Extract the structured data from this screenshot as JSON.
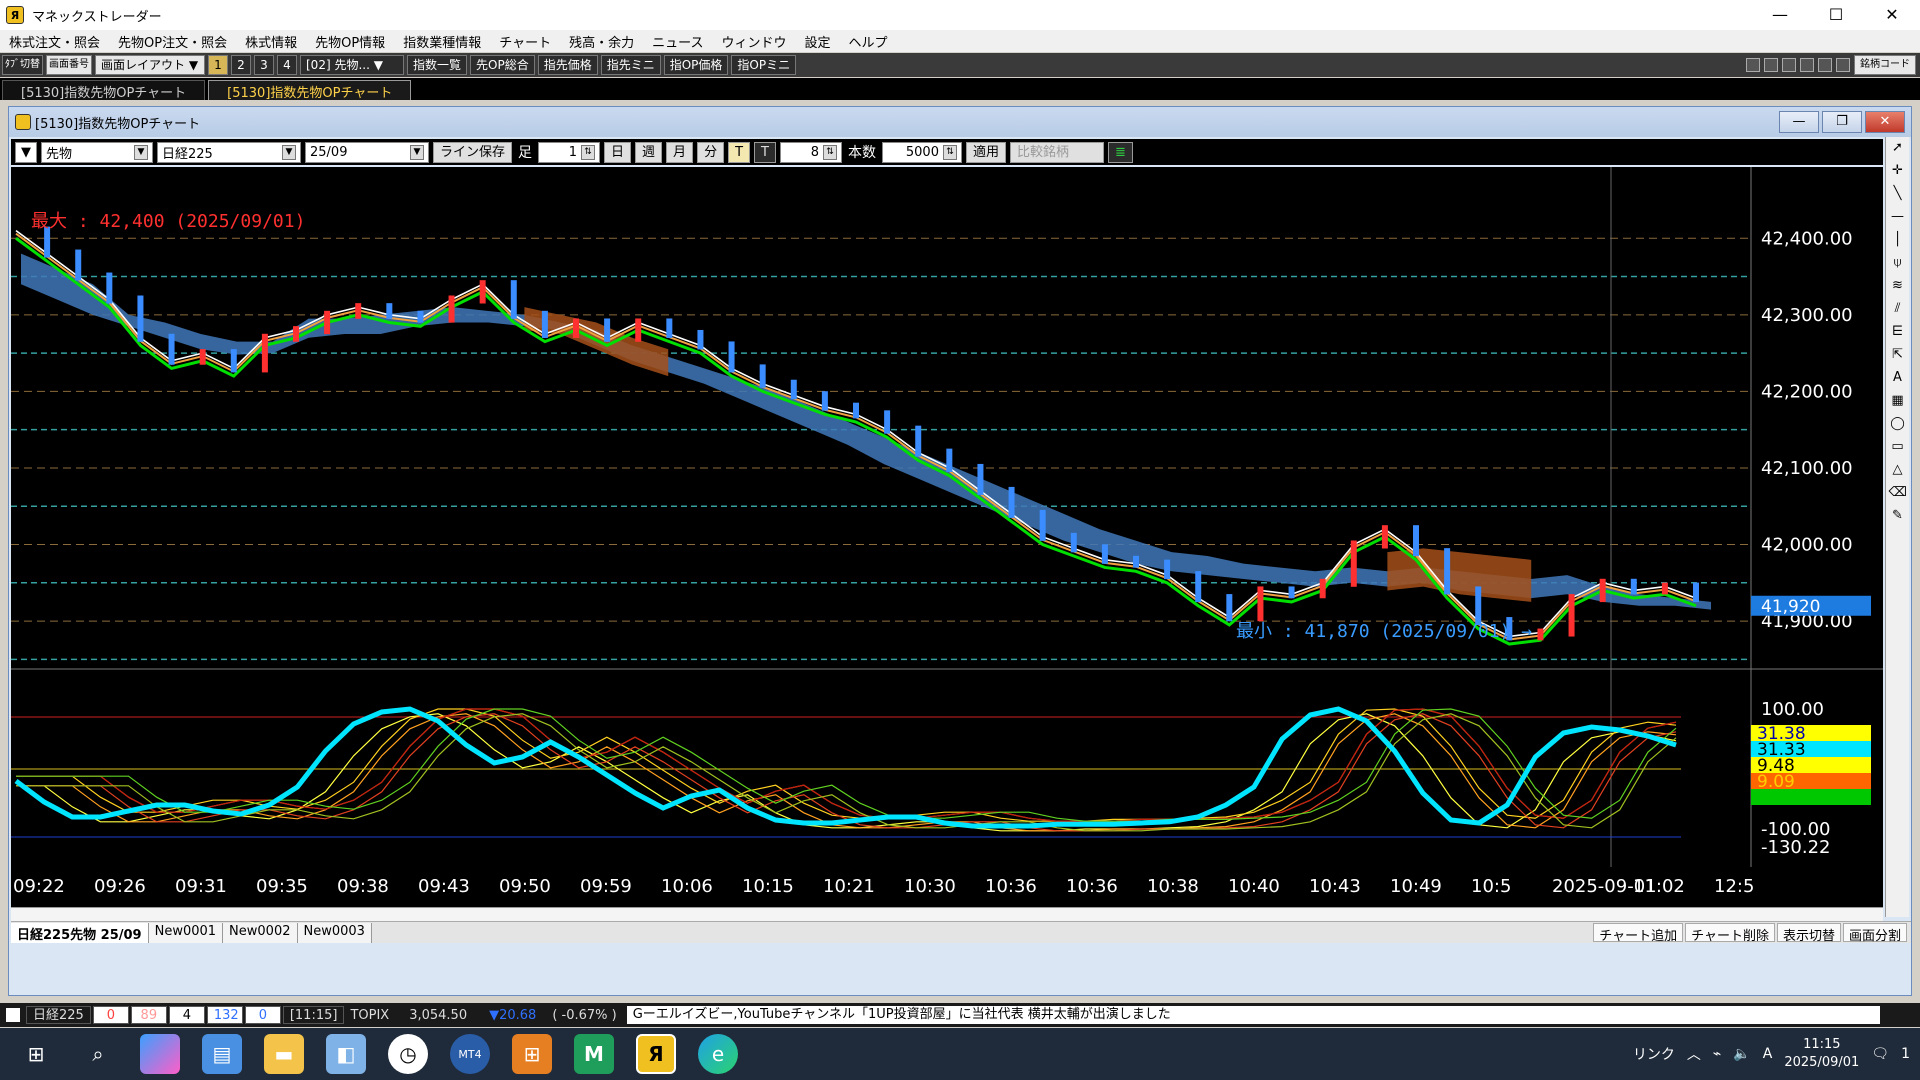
{
  "app": {
    "title": "マネックストレーダー",
    "icon": "monex-icon"
  },
  "window_controls": [
    "—",
    "☐",
    "✕"
  ],
  "menu": [
    "株式注文・照会",
    "先物OP注文・照会",
    "株式情報",
    "先物OP情報",
    "指数業種情報",
    "チャート",
    "残高・余力",
    "ニュース",
    "ウィンドウ",
    "設定",
    "ヘルプ"
  ],
  "toolbar": {
    "switch_label": "ﾀﾌﾞ切替",
    "code_label": "画面番号",
    "layout_label": "画面レイアウト",
    "layout_nums": [
      "1",
      "2",
      "3",
      "4"
    ],
    "screen_select": "[02] 先物...",
    "buttons": [
      "指数一覧",
      "先OP総合",
      "指先価格",
      "指先ミニ",
      "指OP価格",
      "指OPミニ"
    ],
    "right_code": "銘柄コード"
  },
  "tabs": [
    "[5130]指数先物OPチャート",
    "[5130]指数先物OPチャート"
  ],
  "child": {
    "title": "[5130]指数先物OPチャート",
    "controls": [
      "—",
      "❐",
      "✕"
    ]
  },
  "chart_toolbar": {
    "type": "先物",
    "index": "日経225",
    "month": "25/09",
    "line_save": "ライン保存",
    "ashi_label": "足",
    "ashi_value": "1",
    "periods": [
      "日",
      "週",
      "月",
      "分",
      "T"
    ],
    "t_label": "T",
    "t_value": "8",
    "count_label": "本数",
    "count_value": "5000",
    "apply": "適用",
    "compare": "比較銘柄"
  },
  "chart_data": {
    "type": "line",
    "title": "",
    "price_axis_ticks": [
      "42,400.00",
      "42,300.00",
      "42,200.00",
      "42,100.00",
      "42,000.00",
      "41,900.00"
    ],
    "price_ylim": [
      41840,
      42480
    ],
    "x_tick_labels": [
      "09:22",
      "09:26",
      "09:31",
      "09:35",
      "09:38",
      "09:43",
      "09:50",
      "09:59",
      "10:06",
      "10:15",
      "10:21",
      "10:30",
      "10:36",
      "10:36",
      "10:38",
      "10:40",
      "10:43",
      "10:49",
      "10:5",
      "2025-09-01",
      "11:02",
      "12:5"
    ],
    "annotations": {
      "max": "最大 : 42,400 (2025/09/01)",
      "min": "最小 : 41,870 (2025/09/01) →"
    },
    "current_price_label": "41,920",
    "close_series": [
      42410,
      42380,
      42350,
      42320,
      42270,
      42240,
      42250,
      42230,
      42270,
      42280,
      42300,
      42310,
      42300,
      42295,
      42320,
      42340,
      42300,
      42275,
      42290,
      42270,
      42290,
      42275,
      42260,
      42230,
      42210,
      42195,
      42180,
      42170,
      42150,
      42120,
      42100,
      42070,
      42040,
      42010,
      41995,
      41980,
      41975,
      41960,
      41930,
      41905,
      41940,
      41935,
      41950,
      42000,
      42020,
      41990,
      41940,
      41900,
      41880,
      41885,
      41930,
      41950,
      41940,
      41945,
      41930
    ],
    "cloud_top": [
      42380,
      42360,
      42340,
      42300,
      42290,
      42275,
      42265,
      42265,
      42295,
      42295,
      42300,
      42305,
      42310,
      42305,
      42300,
      42290,
      42280,
      42260,
      42245,
      42230,
      42215,
      42200,
      42180,
      42160,
      42140,
      42120,
      42100,
      42080,
      42060,
      42040,
      42020,
      42005,
      41990,
      41985,
      41975,
      41970,
      41965,
      41970,
      41965,
      41970,
      41965,
      41960,
      41955,
      41960,
      41945,
      41935,
      41930,
      41925
    ],
    "cloud_bottom": [
      42340,
      42320,
      42300,
      42285,
      42270,
      42255,
      42248,
      42250,
      42270,
      42275,
      42275,
      42285,
      42290,
      42290,
      42285,
      42280,
      42260,
      42240,
      42225,
      42210,
      42190,
      42170,
      42150,
      42130,
      42105,
      42085,
      42065,
      42045,
      42025,
      42005,
      41990,
      41975,
      41965,
      41960,
      41955,
      41950,
      41945,
      41950,
      41945,
      41950,
      41940,
      41935,
      41930,
      41935,
      41925,
      41920,
      41920,
      41915
    ],
    "osc_axis_ticks": [
      "100.00",
      "-100.00",
      "-130.22"
    ],
    "osc_ylim": [
      -130,
      120
    ],
    "osc_badges": [
      {
        "text": "31.38",
        "bg": "#ffff00",
        "fg": "#0000aa"
      },
      {
        "text": "31.33",
        "bg": "#00e5ff",
        "fg": "#000"
      },
      {
        "text": "9.48",
        "bg": "#ffff00",
        "fg": "#000"
      },
      {
        "text": "9.09",
        "bg": "#ff6600",
        "fg": "#ffcc00"
      },
      {
        "text": "",
        "bg": "#00c800",
        "fg": "#000"
      }
    ],
    "osc_main": [
      -20,
      -55,
      -80,
      -80,
      -70,
      -60,
      -60,
      -70,
      -75,
      -60,
      -30,
      30,
      75,
      95,
      100,
      80,
      40,
      10,
      20,
      45,
      20,
      -10,
      -40,
      -65,
      -45,
      -35,
      -65,
      -85,
      -90,
      -90,
      -85,
      -80,
      -80,
      -90,
      -95,
      -95,
      -95,
      -92,
      -92,
      -92,
      -90,
      -88,
      -80,
      -60,
      -30,
      50,
      90,
      100,
      80,
      30,
      -40,
      -85,
      -90,
      -60,
      20,
      60,
      70,
      65,
      55,
      40
    ]
  },
  "sheet_tabs": [
    "日経225先物 25/09",
    "New0001",
    "New0002",
    "New0003"
  ],
  "sheet_buttons": [
    "チャート追加",
    "チャート削除",
    "表示切替",
    "画面分割"
  ],
  "statusbar": {
    "index_name": "日経225",
    "cells": [
      "0",
      "89",
      "4",
      "132",
      "0"
    ],
    "time": "[11:15]",
    "topix_label": "TOPIX",
    "topix_value": "3,054.50",
    "topix_change": "▼20.68",
    "topix_pct": "( -0.67% )",
    "news": "Gーエルイズビー,YouTubeチャンネル「1UP投資部屋」に当社代表 横井太輔が出演しました"
  },
  "taskbar": {
    "icons": [
      "windows-start-icon",
      "search-icon",
      "copilot-icon",
      "widgets-icon",
      "file-explorer-icon",
      "app-icon",
      "clock-icon",
      "mt4-icon",
      "apps-grid-icon",
      "m-app-icon",
      "monex-trader-icon",
      "edge-icon"
    ],
    "tray_link": "リンク",
    "time": "11:15",
    "date": "2025/09/01",
    "ime": "A",
    "notification_count": "1"
  }
}
